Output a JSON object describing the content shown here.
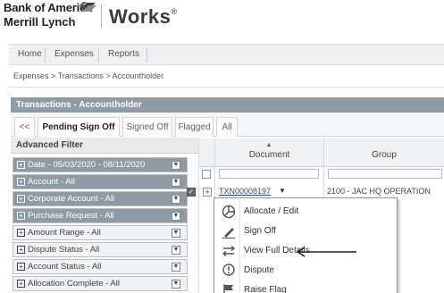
{
  "brand": {
    "line1": "Bank of America",
    "line2": "Merrill Lynch",
    "product": "Works",
    "product_mark": "®",
    "flag_icon": "bank-of-america-flag-icon"
  },
  "topnav": {
    "items": [
      "Home",
      "Expenses",
      "Reports"
    ]
  },
  "breadcrumb": "Expenses > Transactions > Accountholder",
  "panel": {
    "title": "Transactions - Accountholder"
  },
  "tabs": {
    "back": "<<",
    "items": [
      "Pending Sign Off",
      "Signed Off",
      "Flagged",
      "All"
    ],
    "active": "Pending Sign Off"
  },
  "filters": {
    "heading": "Advanced Filter",
    "items": [
      {
        "label": "Date - 05/03/2020 - 08/11/2020",
        "state": "dark"
      },
      {
        "label": "Account - All",
        "state": "dark"
      },
      {
        "label": "Corporate Account - All",
        "state": "dark"
      },
      {
        "label": "Purchase Request - All",
        "state": "dark"
      },
      {
        "label": "Amount Range - All",
        "state": "light"
      },
      {
        "label": "Dispute Status - All",
        "state": "light"
      },
      {
        "label": "Account Status - All",
        "state": "light"
      },
      {
        "label": "Allocation Complete - All",
        "state": "light"
      }
    ]
  },
  "table": {
    "columns": [
      "Document",
      "Group"
    ],
    "row": {
      "id": "TXN00008197",
      "group": "2100 - JAC HQ OPERATION"
    }
  },
  "menu": {
    "items": [
      {
        "label": "Allocate / Edit",
        "icon": "allocate-edit-icon"
      },
      {
        "label": "Sign Off",
        "icon": "sign-off-pen-icon"
      },
      {
        "label": "View Full Details",
        "icon": "view-details-arrows-icon"
      },
      {
        "label": "Dispute",
        "icon": "dispute-speech-icon"
      },
      {
        "label": "Raise Flag",
        "icon": "raise-flag-icon"
      }
    ]
  },
  "colors": {
    "panel_header": "#8d9aa4",
    "filter_active": "#8e9aa4",
    "link": "#2a4a8a"
  }
}
